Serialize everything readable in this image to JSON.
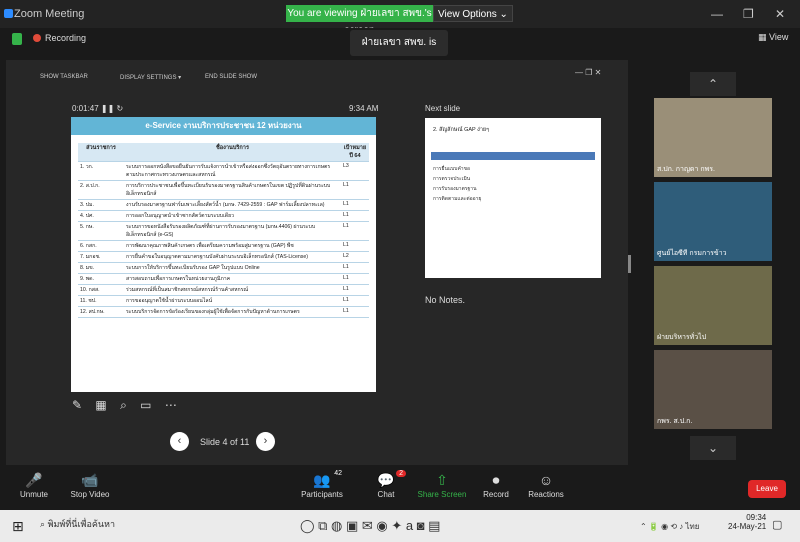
{
  "window": {
    "title": "Zoom Meeting",
    "viewing_banner": "You are viewing ฝ่ายเลขา สพข.'s screen",
    "view_options": "View Options ⌄",
    "view_btn": "View"
  },
  "status": {
    "recording": "Recording",
    "talking": "ฝ่ายเลขา สพข. is talking..."
  },
  "ppt_toolbar": {
    "show_taskbar": "SHOW TASKBAR",
    "display_settings": "DISPLAY SETTINGS ▾",
    "end_show": "END SLIDE SHOW"
  },
  "presenter": {
    "timer": "0:01:47",
    "clock": "9:34 AM",
    "next_slide": "Next slide",
    "no_notes": "No Notes.",
    "slide_count": "Slide 4 of 11"
  },
  "slide": {
    "title": "e-Service งานบริการประชาชน 12 หน่วยงาน",
    "headers": [
      "ส่วนราชการ",
      "ชื่องานบริการ",
      "เป้าหมาย ปี 64"
    ],
    "rows": [
      [
        "1. วก.",
        "ระบบการออกหนังสือขอยืนยันการรับแจ้งการนำเข้าหรือส่งออกซึ่งวัตถุอันตรายทางการเกษตร ตามประกาศกระทรวงเกษตรและสหกรณ์",
        "L3"
      ],
      [
        "2. ส.ป.ก.",
        "การบริการประชาชนเพื่อขึ้นทะเบียนรับรองมาตรฐานสินค้าเกษตรในเขต ปฏิรูปที่ดินผ่านระบบอิเล็กทรอนิกส์",
        "L1"
      ],
      [
        "3. ปม.",
        "งานรับรองมาตรฐานฟาร์มเพาะเลี้ยงสัตว์น้ำ (มกษ. 7429-2559 : GAP ฟาร์มเลี้ยงปลาทะเล)",
        "L1"
      ],
      [
        "4. ปศ.",
        "การออกใบอนุญาตนำเข้าซากสัตว์ตามระบบเดียว",
        "L1"
      ],
      [
        "5. กษ.",
        "ระบบการขอหนังสือรับรองผลิตภัณฑ์ที่ผ่านการรับรองมาตรฐาน (มกษ.4406) ผ่านระบบอิเล็กทรอนิกส์ (e-GS)",
        "L1"
      ],
      [
        "6. กสก.",
        "การพัฒนาคุณภาพสินค้าเกษตร เพื่อเตรียมความพร้อมสู่มาตรฐาน (GAP) พืช",
        "L1"
      ],
      [
        "7. มกอช.",
        "การยื่นคำขอใบอนุญาตตามมาตรฐานบังคับผ่านระบบอิเล็กทรอนิกส์ (TAS-License)",
        "L2"
      ],
      [
        "8. มข.",
        "ระบบการให้บริการขึ้นทะเบียนรับรอง GAP ในรูปแบบ Online",
        "L1"
      ],
      [
        "9. พด.",
        "สารสอบถามเพื่อการเกษตรในหน่วยงานภูมิภาค",
        "L1"
      ],
      [
        "10. กสส.",
        "ร่วมสหกรณ์ที่เป็นสมาชิกสหกรณ์สหกรณ์ร้านค้าสหกรณ์",
        "L1"
      ],
      [
        "11. ชป.",
        "การขออนุญาตใช้น้ำผ่านระบบออนไลน์",
        "L1"
      ],
      [
        "12. สป.กษ.",
        "ระบบบริการจัดการข้อร้องเรียนของกลุ่มผู้ใช้เพื่อจัดการกับปัญหาด้านการเกษตร",
        "L1"
      ]
    ]
  },
  "next_slide": {
    "title": "2. สัญลักษณ์ GAP ง่ายๆ",
    "lines": [
      "การยื่นแบบคำขอ",
      "การตรวจประเมิน",
      "การรับรองมาตรฐาน",
      "การติดตามและต่ออายุ"
    ]
  },
  "participants": [
    {
      "name": "ส.ปก. กาญดา กพร.",
      "bg": "#9a8f78"
    },
    {
      "name": "ศูนย์ไอซีที กรมการข้าว",
      "bg": "#2f5d7a"
    },
    {
      "name": "ฝ่ายบริหารทั่วไป",
      "bg": "#6e6a4a"
    },
    {
      "name": "กพร. ส.ป.ก.",
      "bg": "#5a5046"
    }
  ],
  "controls": [
    {
      "label": "Unmute",
      "icon": "🎤"
    },
    {
      "label": "Stop Video",
      "icon": "📹"
    },
    {
      "label": "Participants",
      "icon": "👥",
      "badge": "42"
    },
    {
      "label": "Chat",
      "icon": "💬",
      "badge": "2"
    },
    {
      "label": "Share Screen",
      "icon": "⇧"
    },
    {
      "label": "Record",
      "icon": "⏺"
    },
    {
      "label": "Reactions",
      "icon": "☺"
    }
  ],
  "leave": "Leave",
  "taskbar": {
    "search": "พิมพ์ที่นี่เพื่อค้นหา",
    "time": "09:34",
    "date": "24-May-21",
    "lang": "ไทย"
  },
  "colors": {
    "accent_green": "#35b34a",
    "leave_red": "#e02828",
    "slide_header": "#62b5d6"
  }
}
